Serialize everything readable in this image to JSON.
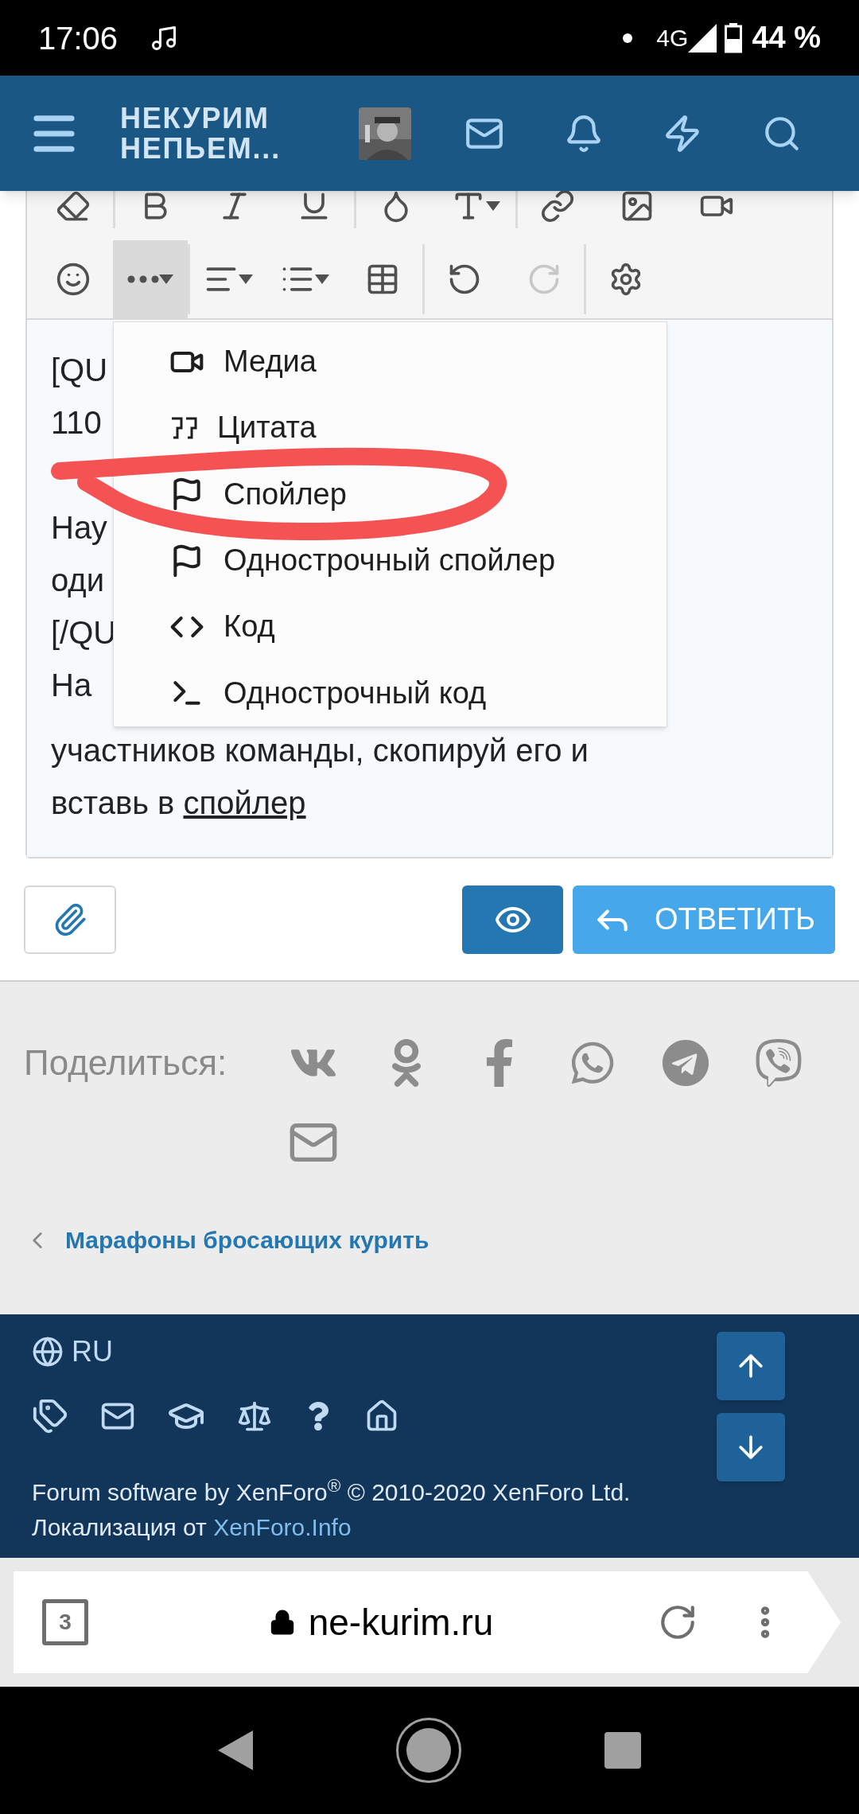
{
  "status_bar": {
    "time": "17:06",
    "network": "4G",
    "battery": "44 %"
  },
  "header": {
    "title_line_1": "НЕКУРИМ",
    "title_line_2": "НЕПЬЕМ..."
  },
  "toolbar": {
    "more_button": {
      "selected": true
    },
    "redo_button": {
      "disabled": true
    }
  },
  "editor": {
    "lines": [
      "[QU",
      "110",
      "Нау",
      "оди",
      "[/QU",
      "На"
    ],
    "last_line": "участников команды, скопируй его и",
    "final_line_text": "вставь в ",
    "final_line_link": "спойлер"
  },
  "insert_menu": {
    "items": [
      "Медиа",
      "Цитата",
      "Спойлер",
      "Однострочный спойлер",
      "Код",
      "Однострочный код"
    ]
  },
  "actions": {
    "reply_button": "ОТВЕТИТЬ"
  },
  "share": {
    "label": "Поделиться:"
  },
  "breadcrumb": {
    "label": "Марафоны бросающих курить"
  },
  "footer": {
    "language": "RU",
    "copyright": "Forum software by XenForo$^{®}$ © 2010-2020 XenForo Ltd.",
    "localization_text": "Локализация от ",
    "localization_link": "XenForo.Info"
  },
  "browser_bar": {
    "tab_count": "3",
    "url": "ne-kurim.ru"
  }
}
